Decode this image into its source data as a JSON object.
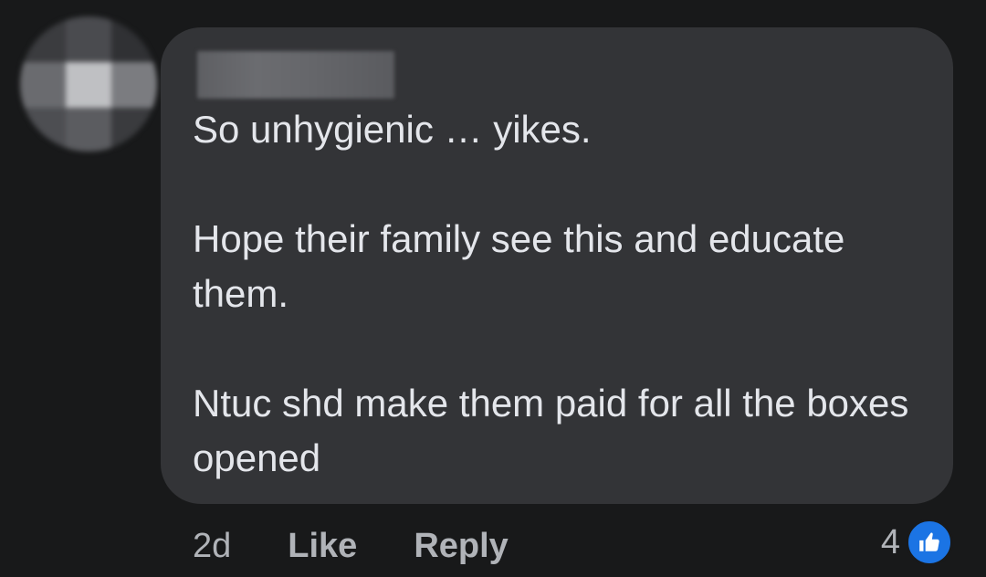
{
  "comment": {
    "lines": [
      "So unhygienic … yikes.",
      "Hope their family see this and educate them.",
      "Ntuc shd make them paid for all the boxes opened"
    ]
  },
  "actions": {
    "timestamp": "2d",
    "like_label": "Like",
    "reply_label": "Reply"
  },
  "reactions": {
    "count": "4",
    "icon": "like-icon",
    "color": "#1b74e4"
  },
  "theme": {
    "background": "#18191a",
    "bubble": "#333437",
    "text": "#e4e6eb",
    "secondary_text": "#b0b3b8"
  }
}
